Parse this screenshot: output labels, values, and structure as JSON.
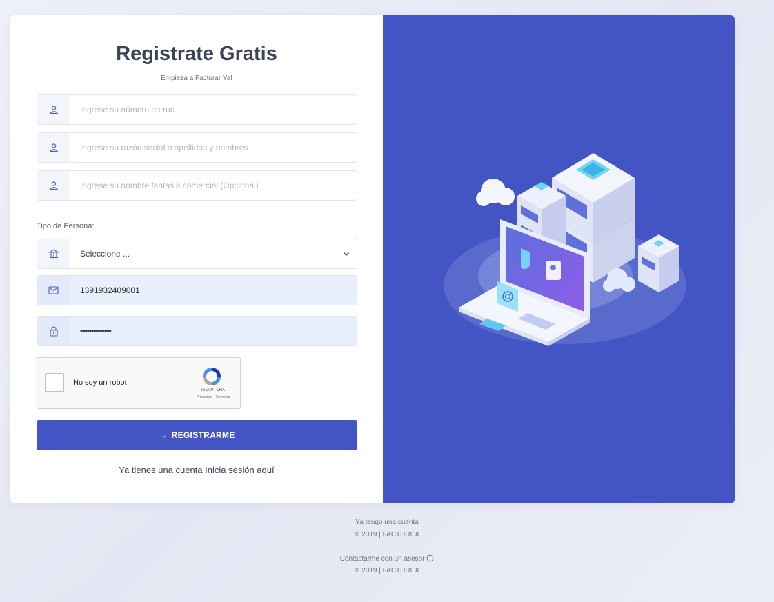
{
  "form": {
    "title": "Registrate Gratis",
    "subtitle": "Empieza a Facturar Ya!",
    "ruc": {
      "placeholder": "Ingrese su número de ruc",
      "icon": "user-icon"
    },
    "razon_social": {
      "placeholder": "Ingrese su razón social o apellidos y nombres",
      "icon": "user-icon"
    },
    "nombre_fantasia": {
      "placeholder": "Ingrese su nombre fantasia comercial (Opcional)",
      "icon": "user-icon"
    },
    "tipo_persona_label": "Tipo de Persona:",
    "tipo_persona": {
      "selected": "Seleccione ...",
      "icon": "bank-icon"
    },
    "email": {
      "value": "1391932409001",
      "icon": "envelope-icon"
    },
    "password": {
      "value": "••••••••••••••",
      "icon": "lock-icon"
    },
    "captcha": {
      "label": "No soy un robot",
      "brand": "reCAPTCHA",
      "links": "Privacidad - Términos"
    },
    "submit_label": "REGISTRARME",
    "login_prefix": "Ya tienes una cuenta",
    "login_link": "Inicia sesión aquí"
  },
  "footer": {
    "line1": "Ya tengo una cuenta",
    "line2": "© 2019 | FACTUREX",
    "line3": "Contactarme con un asesor",
    "line4": "© 2019 | FACTUREX"
  },
  "colors": {
    "primary": "#4354c4",
    "filled_input": "#e8f0fe"
  }
}
